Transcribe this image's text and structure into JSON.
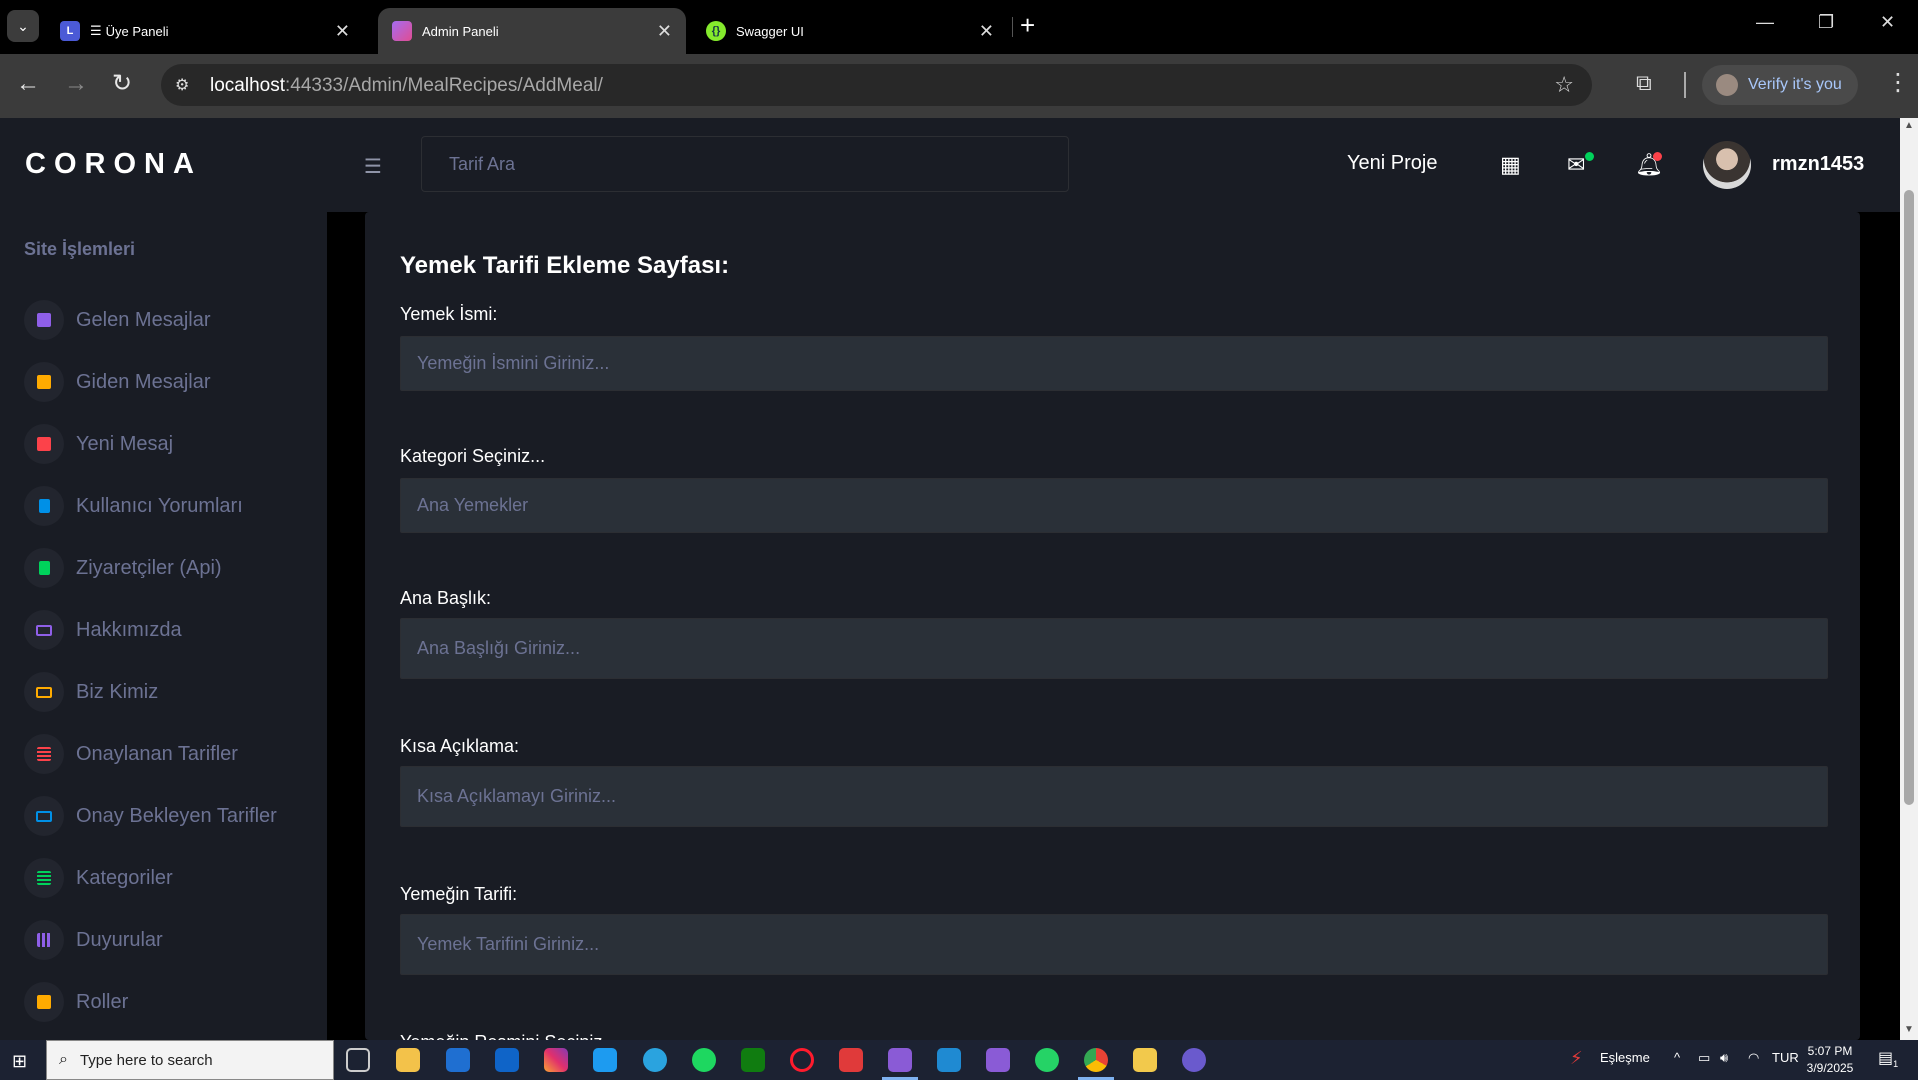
{
  "browser": {
    "tabs": [
      {
        "title": "Üye Paneli",
        "prefix": "☰",
        "favicon_color": "#4b5ad6",
        "active": false
      },
      {
        "title": "Admin Paneli",
        "favicon_color": "#a56cf2",
        "active": true
      },
      {
        "title": "Swagger UI",
        "favicon_color": "#85ea2d",
        "active": false
      }
    ],
    "url_host": "localhost",
    "url_rest": ":44333/Admin/MealRecipes/AddMeal/",
    "verify_label": "Verify it's you"
  },
  "app": {
    "brand": "CORONA",
    "search_placeholder": "Tarif Ara",
    "new_project": "Yeni Proje",
    "username": "rmzn1453",
    "sidebar": {
      "category": "Site İşlemleri",
      "items": [
        {
          "label": "Gelen Mesajlar",
          "icon": "message-icon",
          "color": "#8f5fe8"
        },
        {
          "label": "Giden Mesajlar",
          "icon": "message-icon",
          "color": "#ffab00"
        },
        {
          "label": "Yeni Mesaj",
          "icon": "message-icon",
          "color": "#fc424a"
        },
        {
          "label": "Kullanıcı Yorumları",
          "icon": "document-icon",
          "color": "#0090e7"
        },
        {
          "label": "Ziyaretçiler (Api)",
          "icon": "document-icon",
          "color": "#00d25b"
        },
        {
          "label": "Hakkımızda",
          "icon": "laptop-icon",
          "color": "#8f5fe8"
        },
        {
          "label": "Biz Kimiz",
          "icon": "laptop-icon",
          "color": "#ffab00"
        },
        {
          "label": "Onaylanan Tarifler",
          "icon": "playlist-icon",
          "color": "#fc424a"
        },
        {
          "label": "Onay Bekleyen Tarifler",
          "icon": "laptop-icon",
          "color": "#0090e7"
        },
        {
          "label": "Kategoriler",
          "icon": "playlist-icon",
          "color": "#00d25b"
        },
        {
          "label": "Duyurular",
          "icon": "grid-icon",
          "color": "#8f5fe8"
        },
        {
          "label": "Roller",
          "icon": "badge-icon",
          "color": "#ffab00"
        }
      ]
    },
    "form": {
      "title": "Yemek Tarifi Ekleme Sayfası:",
      "fields": [
        {
          "label": "Yemek İsmi:",
          "placeholder": "Yemeğin İsmini Giriniz..."
        },
        {
          "label": "Kategori Seçiniz...",
          "placeholder": "Ana Yemekler"
        },
        {
          "label": "Ana Başlık:",
          "placeholder": "Ana Başlığı Giriniz..."
        },
        {
          "label": "Kısa Açıklama:",
          "placeholder": "Kısa Açıklamayı Giriniz..."
        },
        {
          "label": "Yemeğin Tarifi:",
          "placeholder": "Yemek Tarifini Giriniz..."
        },
        {
          "label": "Yemeğin Resmini Seçiniz",
          "placeholder": ""
        }
      ]
    }
  },
  "taskbar": {
    "search_placeholder": "Type here to search",
    "tray_label": "Eşleşme",
    "language": "TUR",
    "time": "5:07 PM",
    "date": "3/9/2025",
    "notification_count": "1"
  }
}
